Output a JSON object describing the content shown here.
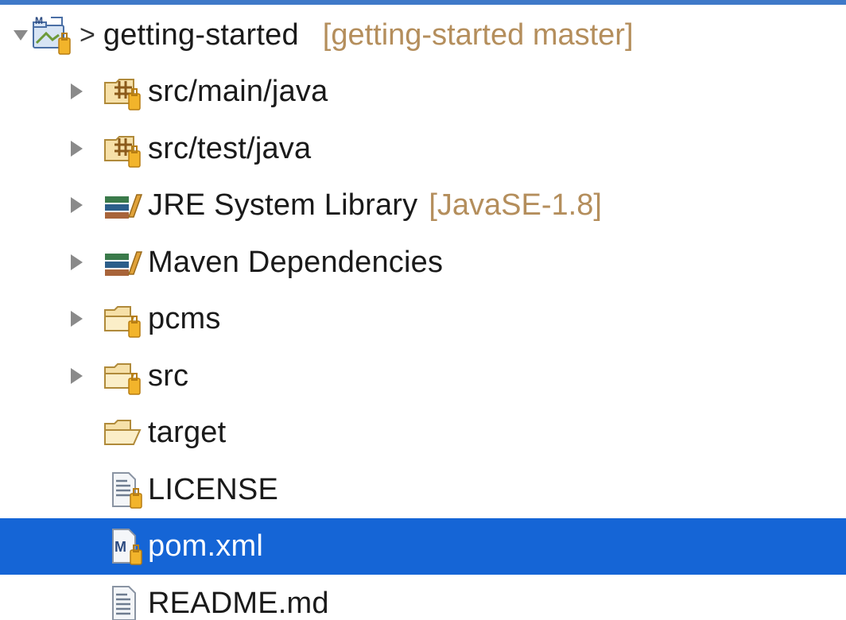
{
  "explorer": {
    "project": {
      "prefix": ">",
      "name": "getting-started",
      "decoration": "[getting-started master]"
    },
    "items": [
      {
        "label": "src/main/java",
        "decoration": "",
        "icon": "source-folder-icon",
        "expandable": true
      },
      {
        "label": "src/test/java",
        "decoration": "",
        "icon": "source-folder-icon",
        "expandable": true
      },
      {
        "label": "JRE System Library",
        "decoration": "[JavaSE-1.8]",
        "icon": "library-icon",
        "expandable": true
      },
      {
        "label": "Maven Dependencies",
        "decoration": "",
        "icon": "library-icon",
        "expandable": true
      },
      {
        "label": "pcms",
        "decoration": "",
        "icon": "folder-icon",
        "expandable": true
      },
      {
        "label": "src",
        "decoration": "",
        "icon": "folder-icon",
        "expandable": true
      },
      {
        "label": "target",
        "decoration": "",
        "icon": "folder-icon",
        "expandable": false
      },
      {
        "label": "LICENSE",
        "decoration": "",
        "icon": "text-file-icon",
        "expandable": false
      },
      {
        "label": "pom.xml",
        "decoration": "",
        "icon": "maven-pom-file-icon",
        "expandable": false,
        "selected": true
      },
      {
        "label": "README.md",
        "decoration": "",
        "icon": "text-file-icon",
        "expandable": false
      }
    ]
  },
  "colors": {
    "selection": "#1565d6",
    "decoration": "#b48e5c",
    "top_edge": "#3f79c8"
  }
}
